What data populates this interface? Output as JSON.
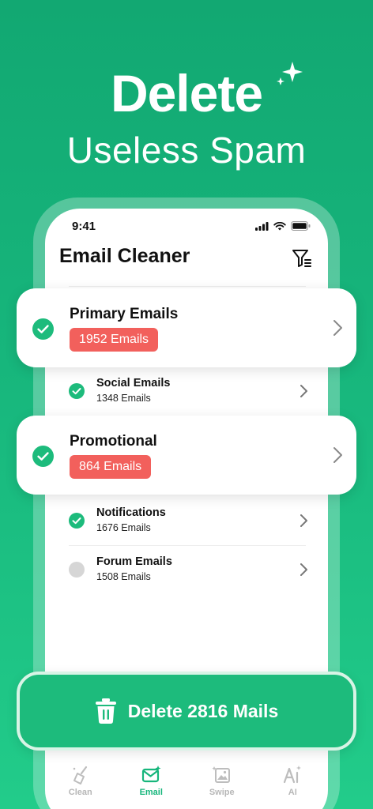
{
  "promo": {
    "line1": "Delete",
    "line2": "Useless Spam"
  },
  "status_bar": {
    "time": "9:41"
  },
  "app": {
    "title": "Email Cleaner"
  },
  "categories": [
    {
      "name": "Primary Emails",
      "count": "1952 Emails",
      "checked": true,
      "highlighted": true
    },
    {
      "name": "Social Emails",
      "count": "1348 Emails",
      "checked": true,
      "highlighted": false
    },
    {
      "name": "Promotional",
      "count": "864 Emails",
      "checked": true,
      "highlighted": true
    },
    {
      "name": "Notifications",
      "count": "1676 Emails",
      "checked": true,
      "highlighted": false
    },
    {
      "name": "Forum Emails",
      "count": "1508 Emails",
      "checked": false,
      "highlighted": false
    }
  ],
  "action": {
    "delete_label": "Delete 2816 Mails"
  },
  "tabs": [
    {
      "label": "Clean",
      "icon": "broom-icon",
      "active": false
    },
    {
      "label": "Email",
      "icon": "mail-icon",
      "active": true
    },
    {
      "label": "Swipe",
      "icon": "photo-swipe-icon",
      "active": false
    },
    {
      "label": "AI",
      "icon": "ai-text-icon",
      "active": false
    }
  ],
  "colors": {
    "brand_green": "#17b67c",
    "badge_red": "#f2605c",
    "unchecked_gray": "#d6d6d6"
  }
}
